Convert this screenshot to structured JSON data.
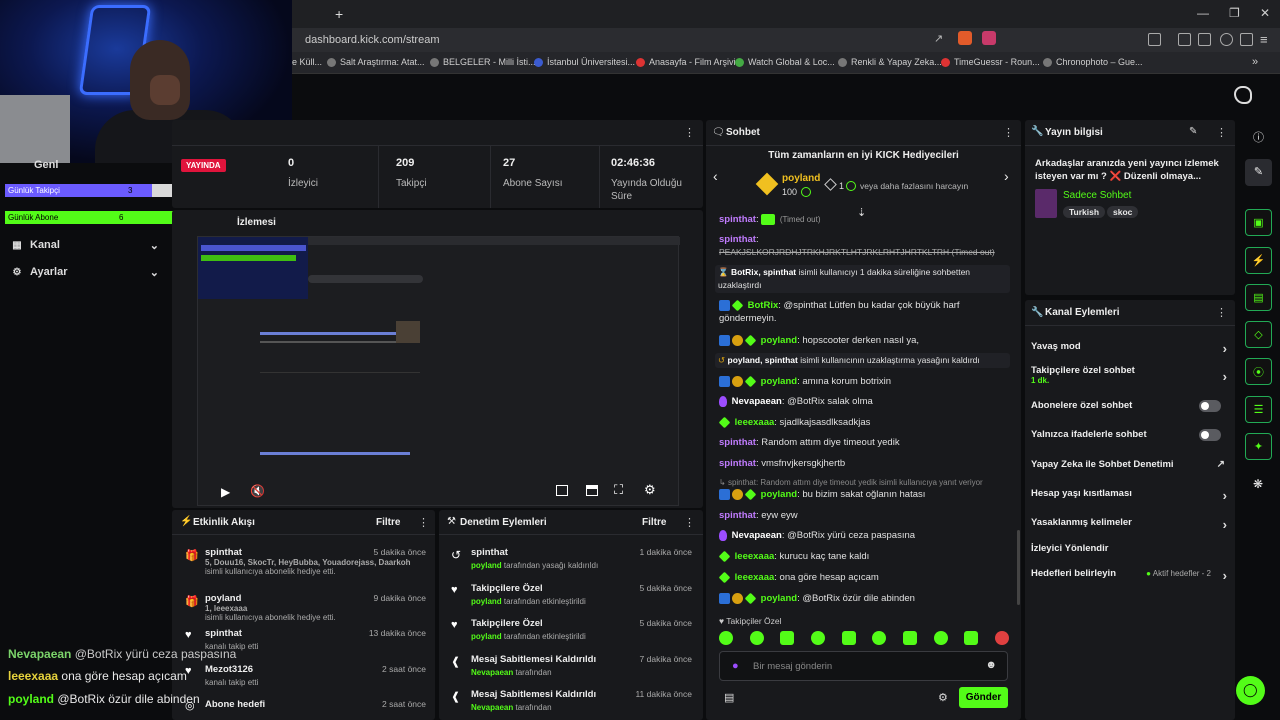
{
  "browser": {
    "url": "dashboard.kick.com/stream",
    "new_tab": "+",
    "bookmarks": [
      "e Küll...",
      "Salt Araştırma: Atat...",
      "BELGELER - Milli İsti...",
      "İstanbul Üniversitesi...",
      "Anasayfa - Film Arşivi",
      "Watch Global & Loc...",
      "Renkli & Yapay Zeka...",
      "TimeGuessr - Roun...",
      "Chronophoto – Gue..."
    ]
  },
  "sidebar": {
    "live_badge": "YAYINDA",
    "goals": [
      {
        "label": "Günlük Takipçi",
        "value": "3",
        "max": "5",
        "fraction": 0.6,
        "color": "#6b5bff"
      },
      {
        "label": "Günlük Abone",
        "value": "6",
        "max": "1",
        "fraction": 1.0,
        "color": "#53fc18"
      }
    ],
    "partial_item": "Genl",
    "items": [
      {
        "label": "Kanal",
        "icon": "channel-icon"
      },
      {
        "label": "Ayarlar",
        "icon": "gear-icon"
      }
    ]
  },
  "stats": [
    {
      "value": "0",
      "label": "İzleyici"
    },
    {
      "value": "209",
      "label": "Takipçi"
    },
    {
      "value": "27",
      "label": "Abone Sayısı"
    },
    {
      "value": "02:46:36",
      "label": "Yayında Olduğu Süre"
    }
  ],
  "preview": {
    "title": "Yayın Önizlemesi",
    "title_partial": "İzlemesi"
  },
  "activity": {
    "title": "Etkinlik Akışı",
    "filter": "Filtre",
    "items": [
      {
        "icon": "gift-icon",
        "name": "spinthat",
        "time": "5 dakika önce",
        "highlight": "5, Douu16, SkocTr, HeyBubba, Youadorejass, Daarkoh",
        "sub": "isimli kullanıcıya abonelik hediye etti."
      },
      {
        "icon": "gift-icon",
        "name": "poyland",
        "time": "9 dakika önce",
        "highlight": "1, leeexaaa",
        "sub": "isimli kullanıcıya abonelik hediye etti."
      },
      {
        "icon": "heart-icon",
        "name": "spinthat",
        "time": "13 dakika önce",
        "highlight": "",
        "sub": "kanalı takip etti"
      },
      {
        "icon": "heart-icon",
        "name": "Mezot3126",
        "time": "2 saat önce",
        "highlight": "",
        "sub": "kanalı takip etti"
      },
      {
        "icon": "target-icon",
        "name": "Abone hedefi",
        "time": "2 saat önce",
        "highlight": "",
        "sub": ""
      }
    ]
  },
  "moderation": {
    "title": "Denetim Eylemleri",
    "filter": "Filtre",
    "items": [
      {
        "icon": "undo-icon",
        "title": "spinthat",
        "time": "1 dakika önce",
        "actor": "poyland",
        "sub": "tarafından yasağı kaldırıldı"
      },
      {
        "icon": "heart-icon",
        "title": "Takipçilere Özel",
        "time": "5 dakika önce",
        "actor": "poyland",
        "sub": "tarafından etkinleştirildi"
      },
      {
        "icon": "heart-icon",
        "title": "Takipçilere Özel",
        "time": "5 dakika önce",
        "actor": "poyland",
        "sub": "tarafından etkinleştirildi"
      },
      {
        "icon": "unpin-icon",
        "title": "Mesaj Sabitlemesi Kaldırıldı",
        "time": "7 dakika önce",
        "actor": "Nevapaean",
        "sub": "tarafından"
      },
      {
        "icon": "unpin-icon",
        "title": "Mesaj Sabitlemesi Kaldırıldı",
        "time": "11 dakika önce",
        "actor": "Nevapaean",
        "sub": "tarafından"
      }
    ]
  },
  "chat": {
    "title": "Sohbet",
    "gifters_title": "Tüm zamanların en iyi KICK Hediyecileri",
    "top_gifter": {
      "name": "poyland",
      "amount": "100"
    },
    "gifter_note_count": "1",
    "gifter_note": "veya daha fazlasını harcayın",
    "messages": [
      {
        "user": "spinthat",
        "text": "(Timed out)",
        "style": "purple",
        "badges": []
      },
      {
        "user": "spinthat",
        "text": "PEAKJSLKORJRDHJTRKHJRKTLHTJRKLRHTJHRTKLTRH (Timed out)",
        "style": "purple",
        "badges": []
      },
      {
        "user": "BotRix, spinthat",
        "text": "isimli kullanıcıyı 1 dakika süreliğine sohbetten uzaklaştırdı",
        "style": "system",
        "badges": []
      },
      {
        "user": "BotRix",
        "text": "@spinthat Lütfen bu kadar çok büyük harf göndermeyin.",
        "style": "green",
        "badges": [
          "blue",
          "green"
        ]
      },
      {
        "user": "poyland",
        "text": "hopscooter derken nasıl ya,",
        "style": "green",
        "badges": [
          "blue",
          "gold",
          "green"
        ]
      },
      {
        "user": "poyland, spinthat",
        "text": "isimli kullanıcının uzaklaştırma yasağını kaldırdı",
        "style": "system",
        "badges": []
      },
      {
        "user": "poyland",
        "text": "amına korum botrixin",
        "style": "green",
        "badges": [
          "blue",
          "gold",
          "green"
        ]
      },
      {
        "user": "Nevapaean",
        "text": "@BotRix salak olma",
        "style": "white",
        "badges": [
          "purple"
        ]
      },
      {
        "user": "leeexaaa",
        "text": "sjadlkajsasdlksadkjas",
        "style": "green",
        "badges": [
          "green"
        ]
      },
      {
        "user": "spinthat",
        "text": "Random attım diye timeout yedik",
        "style": "purple",
        "badges": []
      },
      {
        "user": "spinthat",
        "text": "vmsfnvjkersgkjhertb",
        "style": "purple",
        "badges": []
      },
      {
        "user": "",
        "text": "spinthat: Random attım diye timeout yedik isimli kullanıcıya yanıt veriyor",
        "style": "reply",
        "badges": []
      },
      {
        "user": "poyland",
        "text": "bu bizim sakat oğlanın hatası",
        "style": "green",
        "badges": [
          "blue",
          "gold",
          "green"
        ]
      },
      {
        "user": "spinthat",
        "text": "eyw eyw",
        "style": "purple",
        "badges": []
      },
      {
        "user": "Nevapaean",
        "text": "@BotRix yürü ceza paspasına",
        "style": "white",
        "badges": [
          "purple"
        ]
      },
      {
        "user": "leeexaaa",
        "text": "kurucu kaç tane kaldı",
        "style": "green",
        "badges": [
          "green"
        ]
      },
      {
        "user": "leeexaaa",
        "text": "ona göre hesap açıcam",
        "style": "green",
        "badges": [
          "green"
        ]
      },
      {
        "user": "poyland",
        "text": "@BotRix özür dile abinden",
        "style": "green",
        "badges": [
          "blue",
          "gold",
          "green"
        ]
      }
    ],
    "mode_label": "Takipçiler Özel",
    "input_placeholder": "Bir mesaj gönderin",
    "send_label": "Gönder"
  },
  "stream_info": {
    "title": "Yayın bilgisi",
    "stream_title": "Arkadaşlar aranızda yeni yayıncı izlemek isteyen var mı ? ❌ Düzenli olmaya...",
    "category": "Sadece Sohbet",
    "tags": [
      "Turkish",
      "skoc"
    ]
  },
  "channel_actions": {
    "title": "Kanal Eylemleri",
    "rows": [
      {
        "label": "Yavaş mod",
        "control": "chevron",
        "sub": ""
      },
      {
        "label": "Takipçilere özel sohbet",
        "control": "chevron",
        "sub": "1 dk."
      },
      {
        "label": "Abonelere özel sohbet",
        "control": "toggle",
        "sub": ""
      },
      {
        "label": "Yalnızca ifadelerle sohbet",
        "control": "toggle",
        "sub": ""
      },
      {
        "label": "Yapay Zeka ile Sohbet Denetimi",
        "control": "external",
        "sub": ""
      },
      {
        "label": "Hesap yaşı kısıtlaması",
        "control": "chevron",
        "sub": ""
      },
      {
        "label": "Yasaklanmış kelimeler",
        "control": "chevron",
        "sub": ""
      },
      {
        "label": "İzleyici Yönlendir",
        "control": "none",
        "sub": ""
      },
      {
        "label": "Hedefleri belirleyin",
        "control": "chevron",
        "sub": "Aktif hedefler - 2"
      }
    ]
  },
  "overlay_chat": [
    {
      "user": "Nevapaean",
      "text": "@BotRix yürü ceza paspasına",
      "color": "#7bd36a"
    },
    {
      "user": "leeexaaa",
      "text": "ona göre hesap açıcam",
      "color": "#e6d23c"
    },
    {
      "user": "poyland",
      "text": "@BotRix özür dile abinden",
      "color": "#53fc18"
    }
  ]
}
